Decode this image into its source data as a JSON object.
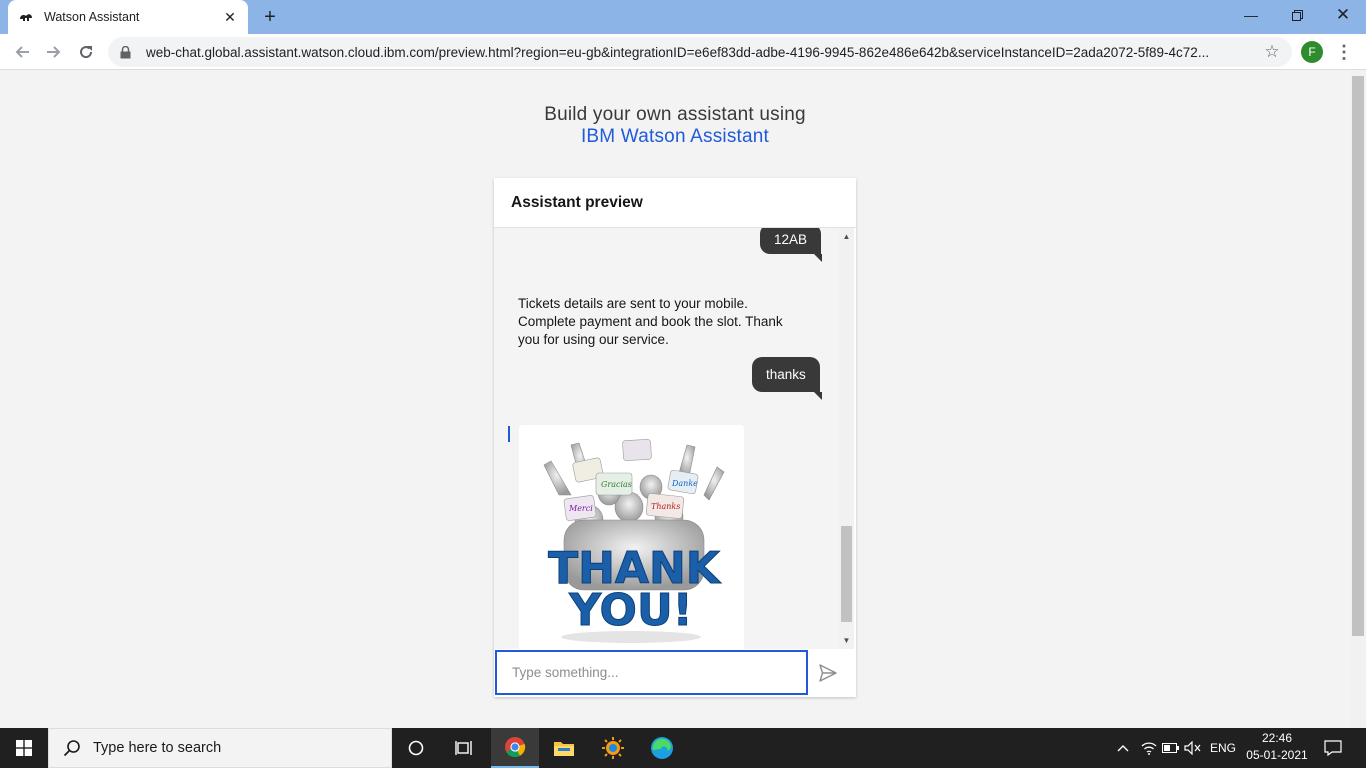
{
  "browser": {
    "tab_title": "Watson Assistant",
    "url": "web-chat.global.assistant.watson.cloud.ibm.com/preview.html?region=eu-gb&integrationID=e6ef83dd-adbe-4196-9945-862e486e642b&serviceInstanceID=2ada2072-5f89-4c72...",
    "profile_initial": "F"
  },
  "page": {
    "headline_line1": "Build your own assistant using",
    "headline_line2": "IBM Watson Assistant"
  },
  "widget": {
    "title": "Assistant preview",
    "messages": [
      {
        "from": "user",
        "text": "12AB"
      },
      {
        "from": "bot",
        "text": "Tickets details are sent to your mobile. Complete payment and book the slot. Thank you for using our service."
      },
      {
        "from": "user",
        "text": "thanks"
      },
      {
        "from": "bot",
        "type": "image",
        "image_text": [
          "THANK",
          "YOU!"
        ],
        "sign_texts": [
          "Gracias",
          "Thanks",
          "Danke",
          "Merci"
        ]
      }
    ],
    "input_placeholder": "Type something..."
  },
  "taskbar": {
    "search_placeholder": "Type here to search",
    "language": "ENG",
    "time": "22:46",
    "date": "05-01-2021"
  },
  "colors": {
    "accent_blue": "#1f5bd8",
    "user_bubble": "#393939",
    "tab_strip": "#8cb4e6"
  }
}
